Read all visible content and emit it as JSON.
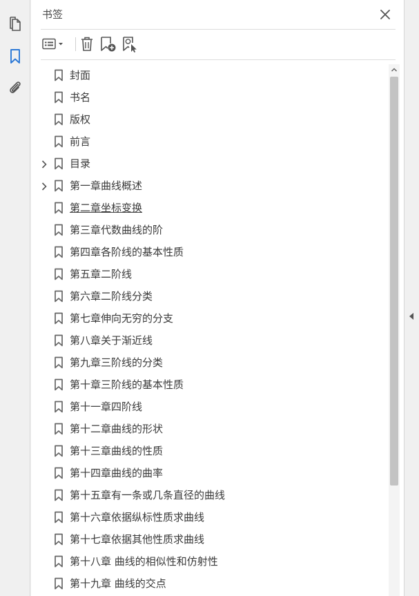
{
  "panel": {
    "title": "书签"
  },
  "rail": {
    "icons": [
      "pages-icon",
      "bookmark-icon",
      "attachment-icon"
    ]
  },
  "toolbar": {
    "icons": [
      "options-menu-icon",
      "delete-icon",
      "new-bookmark-icon",
      "new-bookmark-from-structure-icon"
    ]
  },
  "colors": {
    "accent": "#2b78d6",
    "scroll_thumb": "#c3c3c3",
    "text": "#3a3a3a"
  },
  "bookmarks": [
    {
      "label": "封面",
      "expandable": false
    },
    {
      "label": "书名",
      "expandable": false
    },
    {
      "label": "版权",
      "expandable": false
    },
    {
      "label": "前言",
      "expandable": false
    },
    {
      "label": "目录",
      "expandable": true
    },
    {
      "label": "第一章曲线概述",
      "expandable": true
    },
    {
      "label": "第二章坐标变换",
      "expandable": false,
      "selected": true
    },
    {
      "label": "第三章代数曲线的阶",
      "expandable": false
    },
    {
      "label": "第四章各阶线的基本性质",
      "expandable": false
    },
    {
      "label": "第五章二阶线",
      "expandable": false
    },
    {
      "label": "第六章二阶线分类",
      "expandable": false
    },
    {
      "label": "第七章伸向无穷的分支",
      "expandable": false
    },
    {
      "label": "第八章关于渐近线",
      "expandable": false
    },
    {
      "label": "第九章三阶线的分类",
      "expandable": false
    },
    {
      "label": "第十章三阶线的基本性质",
      "expandable": false
    },
    {
      "label": "第十一章四阶线",
      "expandable": false
    },
    {
      "label": "第十二章曲线的形状",
      "expandable": false
    },
    {
      "label": "第十三章曲线的性质",
      "expandable": false
    },
    {
      "label": "第十四章曲线的曲率",
      "expandable": false
    },
    {
      "label": "第十五章有一条或几条直径的曲线",
      "expandable": false
    },
    {
      "label": "第十六章依据纵标性质求曲线",
      "expandable": false
    },
    {
      "label": "第十七章依据其他性质求曲线",
      "expandable": false
    },
    {
      "label": "第十八章 曲线的相似性和仿射性",
      "expandable": false
    },
    {
      "label": "第十九章 曲线的交点",
      "expandable": false
    }
  ]
}
